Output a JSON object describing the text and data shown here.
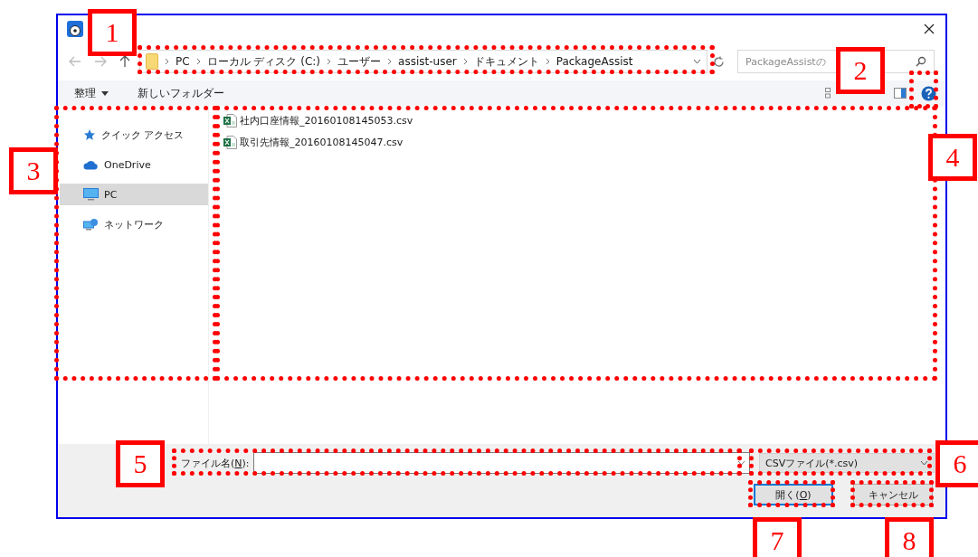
{
  "address_bar": {
    "path": [
      "PC",
      "ローカル ディスク (C:)",
      "ユーザー",
      "assist-user",
      "ドキュメント",
      "PackageAssist"
    ]
  },
  "search": {
    "placeholder": "PackageAssistの"
  },
  "toolbar": {
    "organize": "整理",
    "new_folder": "新しいフォルダー"
  },
  "sidebar": {
    "items": [
      {
        "label": "クイック アクセス",
        "kind": "quick-access",
        "selected": false
      },
      {
        "label": "OneDrive",
        "kind": "cloud",
        "selected": false
      },
      {
        "label": "PC",
        "kind": "pc",
        "selected": true
      },
      {
        "label": "ネットワーク",
        "kind": "network",
        "selected": false
      }
    ]
  },
  "files": [
    {
      "name": "社内口座情報_20160108145053.csv"
    },
    {
      "name": "取引先情報_20160108145047.csv"
    }
  ],
  "file_name": {
    "label": {
      "before": "ファイル名(",
      "key": "N",
      "after": "):"
    }
  },
  "file_type": {
    "value": "CSVファイル(*.csv)"
  },
  "buttons": [
    {
      "before": "開く(",
      "key": "O",
      "after": ")",
      "default": true
    },
    {
      "before": "キャンセル",
      "default": false
    }
  ],
  "annotations": [
    {
      "label": "1"
    },
    {
      "label": "2"
    },
    {
      "label": "3"
    },
    {
      "label": "4"
    },
    {
      "label": "5"
    },
    {
      "label": "6"
    },
    {
      "label": "7"
    },
    {
      "label": "8"
    }
  ]
}
